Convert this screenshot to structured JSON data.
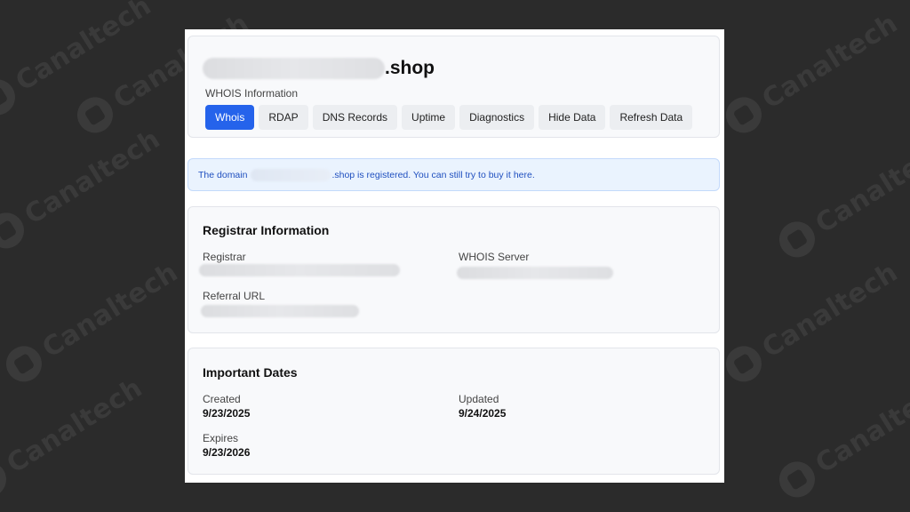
{
  "watermark": {
    "text": "Canaltech"
  },
  "header": {
    "domain_suffix": ".shop",
    "subtitle": "WHOIS Information",
    "tabs": [
      {
        "label": "Whois",
        "active": true
      },
      {
        "label": "RDAP",
        "active": false
      },
      {
        "label": "DNS Records",
        "active": false
      },
      {
        "label": "Uptime",
        "active": false
      },
      {
        "label": "Diagnostics",
        "active": false
      },
      {
        "label": "Hide Data",
        "active": false
      },
      {
        "label": "Refresh Data",
        "active": false
      }
    ]
  },
  "notice": {
    "prefix": "The domain",
    "suffix": ".shop is registered. You can still try to buy it",
    "link": "here."
  },
  "registrar": {
    "title": "Registrar Information",
    "registrar_label": "Registrar",
    "whois_server_label": "WHOIS Server",
    "referral_label": "Referral URL"
  },
  "dates": {
    "title": "Important Dates",
    "created_label": "Created",
    "created_value": "9/23/2025",
    "updated_label": "Updated",
    "updated_value": "9/24/2025",
    "expires_label": "Expires",
    "expires_value": "9/23/2026"
  },
  "colors": {
    "accent": "#2563eb",
    "notice_bg": "#eaf3fe",
    "page_bg": "#2b2b2b"
  }
}
